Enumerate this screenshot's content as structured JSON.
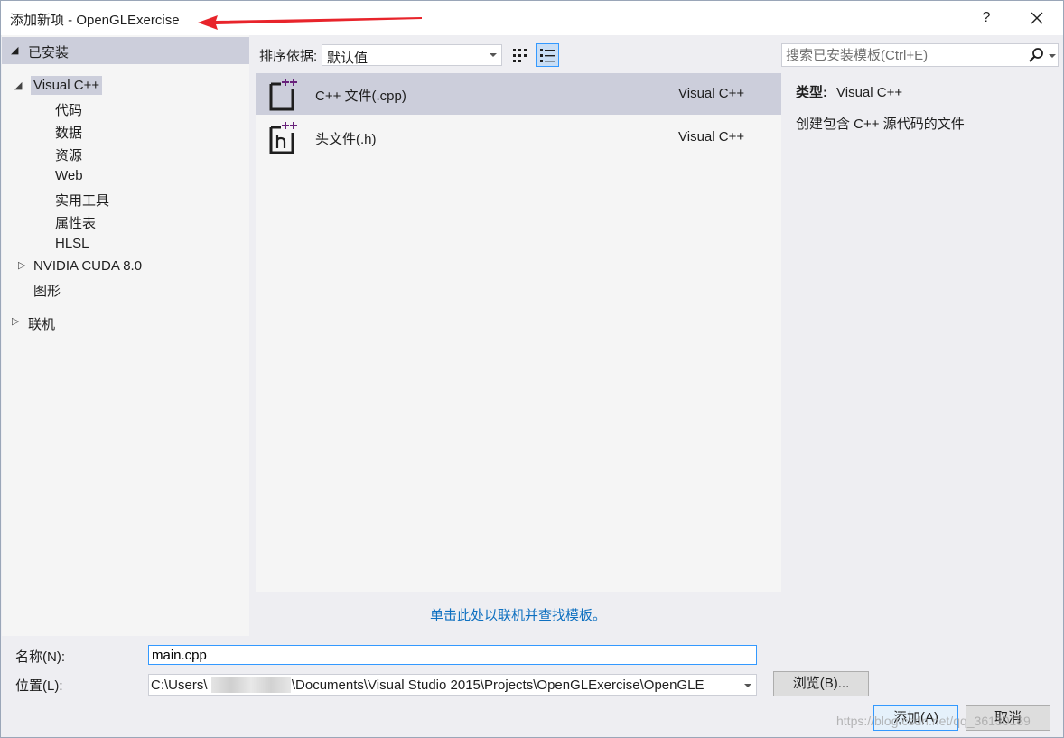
{
  "window": {
    "title": "添加新项 - OpenGLExercise",
    "help_label": "?"
  },
  "tree": {
    "header": "已安装",
    "items": [
      {
        "label": "Visual C++"
      },
      {
        "label": "代码"
      },
      {
        "label": "数据"
      },
      {
        "label": "资源"
      },
      {
        "label": "Web"
      },
      {
        "label": "实用工具"
      },
      {
        "label": "属性表"
      },
      {
        "label": "HLSL"
      },
      {
        "label": "NVIDIA CUDA 8.0"
      },
      {
        "label": "图形"
      },
      {
        "label": "联机"
      }
    ]
  },
  "toolbar": {
    "sort_label": "排序依据:",
    "sort_value": "默认值",
    "search_placeholder": "搜索已安装模板(Ctrl+E)"
  },
  "templates": [
    {
      "name": "C++ 文件(.cpp)",
      "type": "Visual C++",
      "icon": "cpp-file-icon"
    },
    {
      "name": "头文件(.h)",
      "type": "Visual C++",
      "icon": "header-file-icon"
    }
  ],
  "details": {
    "type_label": "类型:",
    "type_value": "Visual C++",
    "description": "创建包含 C++ 源代码的文件"
  },
  "online_link": "单击此处以联机并查找模板。",
  "form": {
    "name_label": "名称(N):",
    "name_value": "main.cpp",
    "location_label": "位置(L):",
    "location_prefix": "C:\\Users\\",
    "location_suffix": "g\\Documents\\Visual Studio 2015\\Projects\\OpenGLExercise\\OpenGLE",
    "browse_label": "浏览(B)...",
    "add_label": "添加(A)",
    "cancel_label": "取消"
  },
  "watermark": "https://blog.csdn.net/qq_36130189",
  "colors": {
    "accent": "#3399ff",
    "selection": "#cccedb",
    "link": "#0e70c0",
    "arrow": "#e8242b",
    "icon_purple": "#68217a"
  }
}
